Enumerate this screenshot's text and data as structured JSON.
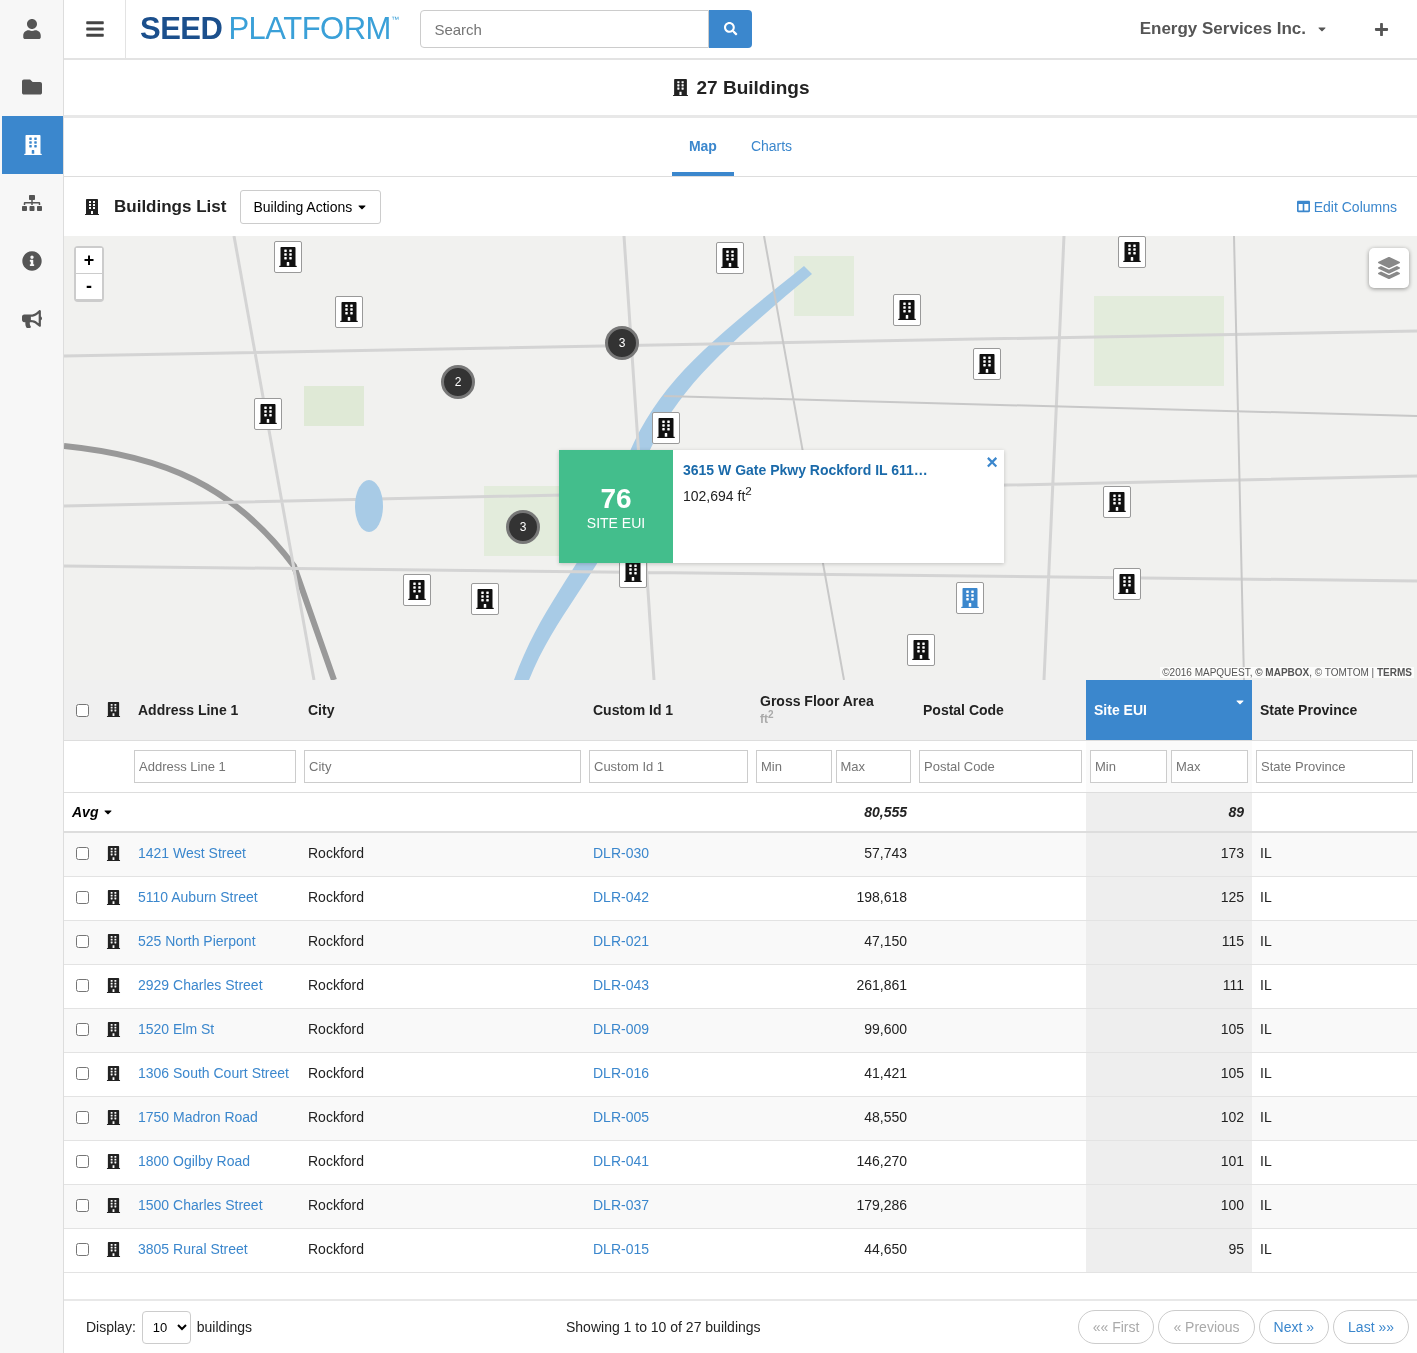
{
  "sidebar": {
    "items": [
      {
        "kind": "user",
        "selected": false
      },
      {
        "kind": "folder",
        "selected": false
      },
      {
        "kind": "building",
        "selected": true
      },
      {
        "kind": "sitemap",
        "selected": false
      },
      {
        "kind": "info",
        "selected": false
      },
      {
        "kind": "bullhorn",
        "selected": false
      }
    ]
  },
  "header": {
    "logo_bold": "SEED",
    "logo_light": "PLATFORM",
    "logo_mark": "™",
    "search": {
      "placeholder": "Search"
    },
    "organization": "Energy Services Inc."
  },
  "page_title": "27 Buildings",
  "tabs": [
    {
      "label": "Map",
      "selected": true
    },
    {
      "label": "Charts",
      "selected": false
    }
  ],
  "list_header": {
    "title": "Buildings List",
    "actions_button": "Building Actions",
    "edit_columns": "Edit Columns"
  },
  "map": {
    "zoom_in": "+",
    "zoom_out": "-",
    "markers": [
      {
        "selected": false
      },
      {
        "selected": false
      },
      {
        "selected": false
      },
      {
        "selected": false
      },
      {
        "selected": false
      },
      {
        "selected": false
      },
      {
        "selected": false
      },
      {
        "selected": false
      },
      {
        "selected": false
      },
      {
        "selected": false
      },
      {
        "selected": false
      },
      {
        "selected": true
      },
      {
        "selected": false
      },
      {
        "selected": false
      },
      {
        "selected": false
      }
    ],
    "clusters": [
      {
        "count": "3"
      },
      {
        "count": "2"
      },
      {
        "count": "3"
      }
    ],
    "popup": {
      "value": "76",
      "label": "SITE EUI",
      "address": "3615 W Gate Pkwy Rockford IL 611…",
      "area": "102,694 ft$^{2}$",
      "close": "×"
    },
    "attribution": "©2016 MAPQUEST, **© MAPBOX**, © TOMTOM | **TERMS**"
  },
  "table": {
    "select_all_checked": false,
    "columns": [
      {
        "kind": "link",
        "label": "Address Line 1",
        "filters": [
          {
            "placeholder": "Address Line 1"
          }
        ],
        "sorted": false
      },
      {
        "kind": "text",
        "label": "City",
        "filters": [
          {
            "placeholder": "City"
          }
        ],
        "sorted": false
      },
      {
        "kind": "link",
        "label": "Custom Id 1",
        "filters": [
          {
            "placeholder": "Custom Id 1"
          }
        ],
        "sorted": false
      },
      {
        "kind": "number",
        "label": "Gross Floor Area",
        "unit": "ft$^{2}$",
        "filters": [
          {
            "placeholder": "Min"
          },
          {
            "placeholder": "Max"
          }
        ],
        "average": "80,555",
        "sorted": false
      },
      {
        "label": "Postal Code",
        "filters": [
          {
            "placeholder": "Postal Code"
          }
        ],
        "sorted": false
      },
      {
        "kind": "number",
        "label": "Site EUI",
        "filters": [
          {
            "placeholder": "Min"
          },
          {
            "placeholder": "Max"
          }
        ],
        "average": "89",
        "sorted": true
      },
      {
        "kind": "text",
        "label": "State Province",
        "filters": [
          {
            "placeholder": "State Province"
          }
        ],
        "sorted": false
      }
    ],
    "average_label": "Avg",
    "rows": [
      {
        "checked": false,
        "cells": [
          "1421 West Street",
          "Rockford",
          "DLR-030",
          "57,743",
          null,
          "173",
          "IL"
        ]
      },
      {
        "checked": false,
        "cells": [
          "5110 Auburn Street",
          "Rockford",
          "DLR-042",
          "198,618",
          null,
          "125",
          "IL"
        ]
      },
      {
        "checked": false,
        "cells": [
          "525 North Pierpont",
          "Rockford",
          "DLR-021",
          "47,150",
          null,
          "115",
          "IL"
        ]
      },
      {
        "checked": false,
        "cells": [
          "2929 Charles Street",
          "Rockford",
          "DLR-043",
          "261,861",
          null,
          "111",
          "IL"
        ]
      },
      {
        "checked": false,
        "cells": [
          "1520 Elm St",
          "Rockford",
          "DLR-009",
          "99,600",
          null,
          "105",
          "IL"
        ]
      },
      {
        "checked": false,
        "cells": [
          "1306 South Court Street",
          "Rockford",
          "DLR-016",
          "41,421",
          null,
          "105",
          "IL"
        ]
      },
      {
        "checked": false,
        "cells": [
          "1750 Madron Road",
          "Rockford",
          "DLR-005",
          "48,550",
          null,
          "102",
          "IL"
        ]
      },
      {
        "checked": false,
        "cells": [
          "1800 Ogilby Road",
          "Rockford",
          "DLR-041",
          "146,270",
          null,
          "101",
          "IL"
        ]
      },
      {
        "checked": false,
        "cells": [
          "1500 Charles Street",
          "Rockford",
          "DLR-037",
          "179,286",
          null,
          "100",
          "IL"
        ]
      },
      {
        "checked": false,
        "cells": [
          "3805 Rural Street",
          "Rockford",
          "DLR-015",
          "44,650",
          null,
          "95",
          "IL"
        ]
      }
    ]
  },
  "footer": {
    "display_label": "Display:",
    "page_size": "10",
    "display_suffix": "buildings",
    "summary": "Showing 1 to 10 of 27 buildings",
    "pager": [
      {
        "label": "«« First",
        "disabled": true
      },
      {
        "label": "« Previous",
        "disabled": true
      },
      {
        "label": "Next »",
        "disabled": false
      },
      {
        "label": "Last »»",
        "disabled": false
      }
    ]
  }
}
